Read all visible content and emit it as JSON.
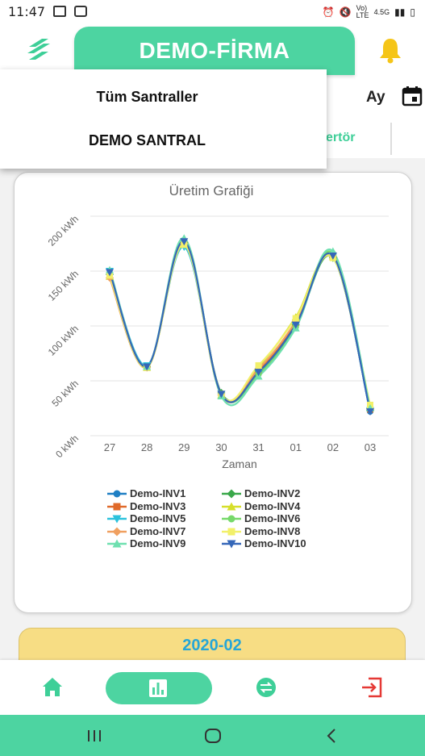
{
  "status_bar": {
    "time": "11:47",
    "network_label": "Vo) LTE",
    "signal_label": "4.5G"
  },
  "header": {
    "title": "DEMO-FİRMA"
  },
  "toolbar": {
    "period_label": "Ay",
    "visible_tab_label": "ertör"
  },
  "dropdown": {
    "items": [
      "Tüm Santraller",
      "DEMO SANTRAL"
    ]
  },
  "chart_data": {
    "type": "line",
    "title": "Üretim Grafiği",
    "xlabel": "Zaman",
    "ylabel": "",
    "categories": [
      "27",
      "28",
      "29",
      "30",
      "31",
      "01",
      "02",
      "03"
    ],
    "y_ticks": [
      "0 kWh",
      "50 kWh",
      "100 kWh",
      "150 kWh",
      "200 kWh"
    ],
    "ylim": [
      0,
      200
    ],
    "grid": true,
    "legend_position": "bottom",
    "series": [
      {
        "name": "Demo-INV1",
        "color": "#1f7fc4",
        "marker": "circle",
        "values": [
          148,
          63,
          177,
          38,
          58,
          102,
          163,
          22
        ]
      },
      {
        "name": "Demo-INV2",
        "color": "#3aa84a",
        "marker": "diamond",
        "values": [
          147,
          63,
          176,
          39,
          59,
          101,
          162,
          23
        ]
      },
      {
        "name": "Demo-INV3",
        "color": "#e06a2a",
        "marker": "square",
        "values": [
          146,
          62,
          176,
          38,
          60,
          103,
          164,
          24
        ]
      },
      {
        "name": "Demo-INV4",
        "color": "#d6df2a",
        "marker": "triangle-up",
        "values": [
          145,
          62,
          174,
          37,
          63,
          108,
          163,
          27
        ]
      },
      {
        "name": "Demo-INV5",
        "color": "#2cc2dc",
        "marker": "triangle-down",
        "values": [
          150,
          64,
          172,
          38,
          57,
          100,
          164,
          23
        ]
      },
      {
        "name": "Demo-INV6",
        "color": "#76d96a",
        "marker": "circle",
        "values": [
          148,
          63,
          175,
          38,
          56,
          99,
          166,
          25
        ]
      },
      {
        "name": "Demo-INV7",
        "color": "#f0a060",
        "marker": "diamond",
        "values": [
          144,
          62,
          175,
          37,
          61,
          104,
          163,
          24
        ]
      },
      {
        "name": "Demo-INV8",
        "color": "#f2f06a",
        "marker": "square",
        "values": [
          146,
          62,
          174,
          38,
          64,
          107,
          162,
          28
        ]
      },
      {
        "name": "Demo-INV9",
        "color": "#6fe0b0",
        "marker": "triangle-up",
        "values": [
          151,
          63,
          180,
          36,
          54,
          98,
          168,
          25
        ]
      },
      {
        "name": "Demo-INV10",
        "color": "#3567b8",
        "marker": "triangle-down",
        "values": [
          149,
          63,
          177,
          38,
          58,
          101,
          164,
          22
        ]
      }
    ]
  },
  "summary": {
    "date_label": "2020-02"
  },
  "bottom_nav": {
    "active": "statistics"
  },
  "colors": {
    "accent": "#4dd4a1",
    "bell": "#f5c518",
    "logout": "#e53935",
    "date_text": "#27a6d6",
    "date_bg": "#f7dd84"
  }
}
